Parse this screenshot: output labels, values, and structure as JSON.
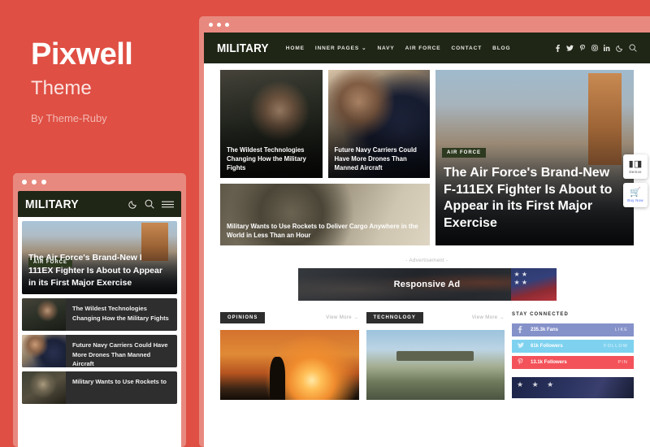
{
  "promo": {
    "title": "Pixwell",
    "subtitle": "Theme",
    "byline": "By Theme-Ruby",
    "bg_color": "#df4f44"
  },
  "mobile_preview": {
    "header": {
      "logo": "MILITARY",
      "icons": [
        "moon-icon",
        "search-icon",
        "hamburger-icon"
      ]
    },
    "hero": {
      "badge": "AIR FORCE",
      "title": "The Air Force's Brand-New F-111EX Fighter Is About to Appear in its First Major Exercise"
    },
    "list": [
      {
        "title": "The Wildest Technologies Changing How the Military Fights"
      },
      {
        "title": "Future Navy Carriers Could Have More Drones Than Manned Aircraft"
      },
      {
        "title": "Military Wants to Use Rockets to"
      }
    ]
  },
  "desktop_preview": {
    "header": {
      "logo": "MILITARY",
      "nav": [
        {
          "label": "HOME",
          "has_caret": false
        },
        {
          "label": "INNER PAGES",
          "has_caret": true
        },
        {
          "label": "NAVY",
          "has_caret": false
        },
        {
          "label": "AIR FORCE",
          "has_caret": false
        },
        {
          "label": "CONTACT",
          "has_caret": false
        },
        {
          "label": "BLOG",
          "has_caret": false
        }
      ],
      "social_icons": [
        "facebook-icon",
        "twitter-icon",
        "pinterest-icon",
        "instagram-icon",
        "linkedin-icon",
        "moon-icon",
        "search-icon"
      ],
      "nav_bg_color": "#1f2616"
    },
    "hero": {
      "small_cards": [
        {
          "title": "The Wildest Technologies Changing How the Military Fights"
        },
        {
          "title": "Future Navy Carriers Could Have More Drones Than Manned Aircraft"
        }
      ],
      "wide_card": {
        "title": "Military Wants to Use Rockets to Deliver Cargo Anywhere in the World in Less Than an Hour"
      },
      "feature": {
        "badge": "AIR FORCE",
        "badge_color": "#2e3a1f",
        "title": "The Air Force's Brand-New F-111EX Fighter Is About to Appear in its First Major Exercise"
      }
    },
    "ad": {
      "label": "- Advertisement -",
      "banner_text": "Responsive Ad"
    },
    "sections": [
      {
        "category": "OPINIONS",
        "view_more": "View More →"
      },
      {
        "category": "TECHNOLOGY",
        "view_more": "View More →"
      }
    ],
    "sidebar": {
      "title": "STAY CONNECTED",
      "socials": [
        {
          "icon": "facebook-icon",
          "count": "235.3k Fans",
          "action": "LIKE",
          "color": "#8591c9"
        },
        {
          "icon": "twitter-icon",
          "count": "61k Followers",
          "action": "FOLLOW",
          "color": "#7ed2ef"
        },
        {
          "icon": "pinterest-icon",
          "count": "13.1k Followers",
          "action": "PIN",
          "color": "#f4525a"
        }
      ]
    }
  },
  "float_buttons": [
    {
      "label": "Demos",
      "icon": "demos-icon"
    },
    {
      "label": "Buy Now",
      "icon": "cart-icon"
    }
  ]
}
